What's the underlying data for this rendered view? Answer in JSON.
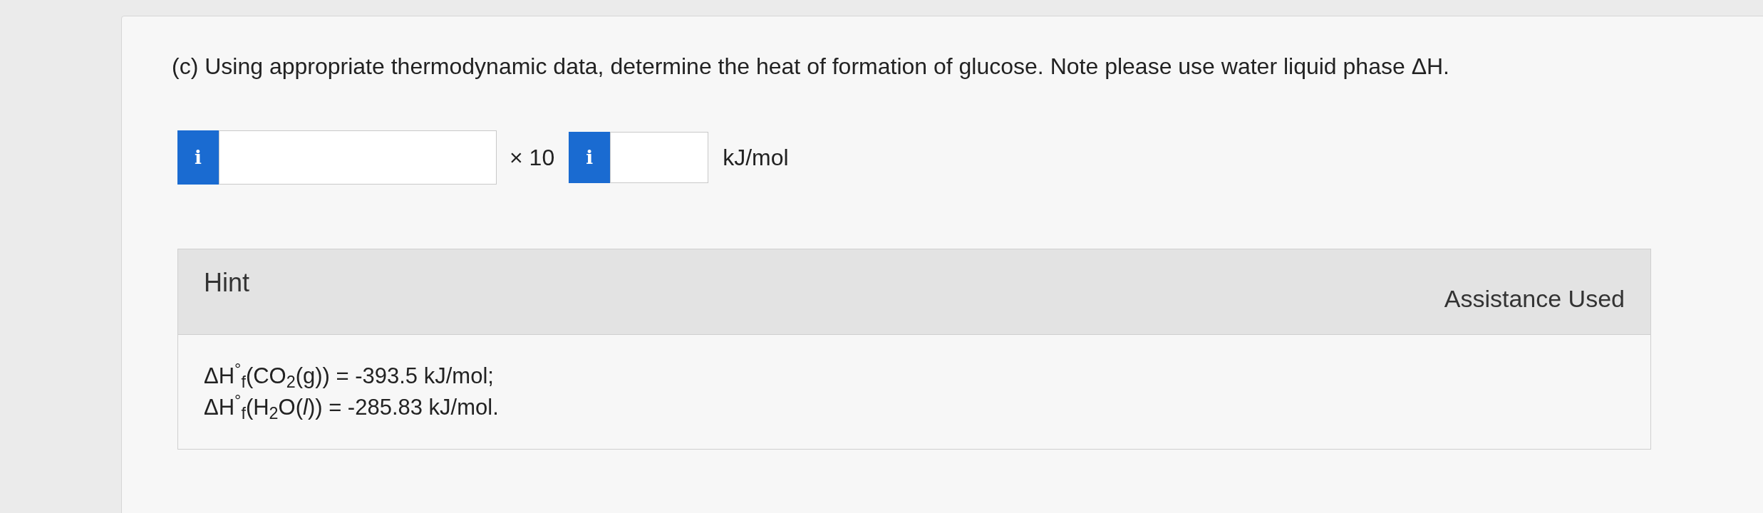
{
  "question": {
    "text": "(c) Using appropriate thermodynamic data, determine the heat of formation of glucose. Note please use water liquid phase ΔH."
  },
  "answer": {
    "mantissa_button": "i",
    "multiplier": "× 10",
    "exponent_button": "i",
    "unit": "kJ/mol"
  },
  "hint": {
    "title": "Hint",
    "status": "Assistance Used",
    "lines": [
      "ΔH$^{°}$$_{f}$(CO$_{2}$(g)) = -393.5 kJ/mol;",
      "ΔH$^{°}$$_{f}$(H$_{2}$O(*l*)) = -285.83 kJ/mol."
    ]
  }
}
